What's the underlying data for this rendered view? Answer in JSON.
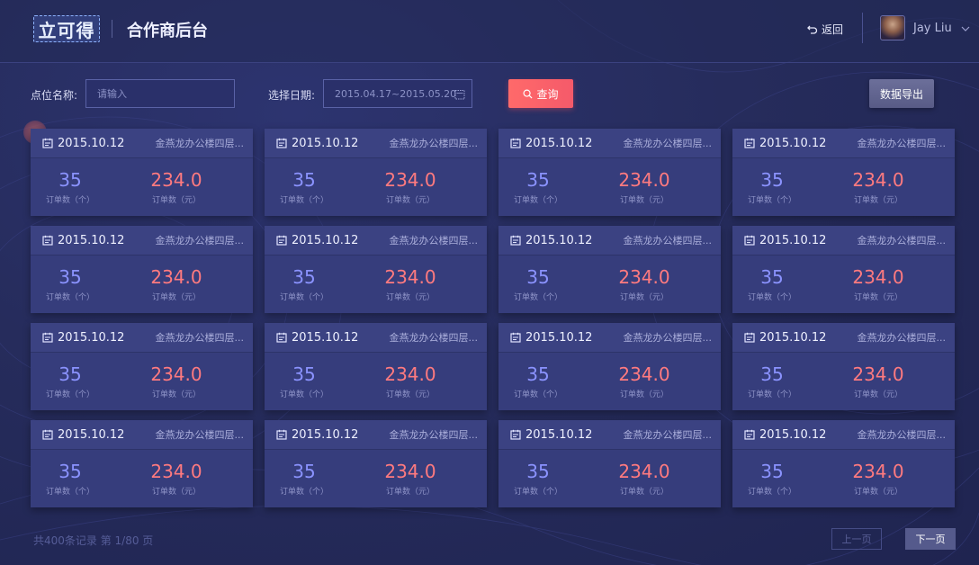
{
  "header": {
    "logo_text": "立可得",
    "title": "合作商后台",
    "back_label": "返回",
    "user_name": "Jay Liu"
  },
  "filters": {
    "location_label": "点位名称:",
    "location_placeholder": "请输入",
    "date_label": "选择日期:",
    "date_range": "2015.04.17~2015.05.20",
    "search_label": "查询",
    "export_label": "数据导出"
  },
  "card_template": {
    "order_count_label": "订单数（个）",
    "order_amount_label": "订单数（元）"
  },
  "cards": [
    {
      "date": "2015.10.12",
      "location": "金燕龙办公楼四层...",
      "order_count": "35",
      "order_amount": "234.0"
    },
    {
      "date": "2015.10.12",
      "location": "金燕龙办公楼四层...",
      "order_count": "35",
      "order_amount": "234.0"
    },
    {
      "date": "2015.10.12",
      "location": "金燕龙办公楼四层...",
      "order_count": "35",
      "order_amount": "234.0"
    },
    {
      "date": "2015.10.12",
      "location": "金燕龙办公楼四层...",
      "order_count": "35",
      "order_amount": "234.0"
    },
    {
      "date": "2015.10.12",
      "location": "金燕龙办公楼四层...",
      "order_count": "35",
      "order_amount": "234.0"
    },
    {
      "date": "2015.10.12",
      "location": "金燕龙办公楼四层...",
      "order_count": "35",
      "order_amount": "234.0"
    },
    {
      "date": "2015.10.12",
      "location": "金燕龙办公楼四层...",
      "order_count": "35",
      "order_amount": "234.0"
    },
    {
      "date": "2015.10.12",
      "location": "金燕龙办公楼四层...",
      "order_count": "35",
      "order_amount": "234.0"
    },
    {
      "date": "2015.10.12",
      "location": "金燕龙办公楼四层...",
      "order_count": "35",
      "order_amount": "234.0"
    },
    {
      "date": "2015.10.12",
      "location": "金燕龙办公楼四层...",
      "order_count": "35",
      "order_amount": "234.0"
    },
    {
      "date": "2015.10.12",
      "location": "金燕龙办公楼四层...",
      "order_count": "35",
      "order_amount": "234.0"
    },
    {
      "date": "2015.10.12",
      "location": "金燕龙办公楼四层...",
      "order_count": "35",
      "order_amount": "234.0"
    },
    {
      "date": "2015.10.12",
      "location": "金燕龙办公楼四层...",
      "order_count": "35",
      "order_amount": "234.0"
    },
    {
      "date": "2015.10.12",
      "location": "金燕龙办公楼四层...",
      "order_count": "35",
      "order_amount": "234.0"
    },
    {
      "date": "2015.10.12",
      "location": "金燕龙办公楼四层...",
      "order_count": "35",
      "order_amount": "234.0"
    },
    {
      "date": "2015.10.12",
      "location": "金燕龙办公楼四层...",
      "order_count": "35",
      "order_amount": "234.0"
    }
  ],
  "pagination": {
    "summary": "共400条记录  第 1/80 页",
    "prev_label": "上一页",
    "next_label": "下一页"
  },
  "colors": {
    "accent_red": "#ff6a6a",
    "count_blue": "#8b93ff",
    "amount_red": "#ff7a7f",
    "card_bg": "#363d7c",
    "page_bg": "#262c5c"
  },
  "icons": {
    "back": "back-arrow-icon",
    "calendar": "calendar-icon",
    "search": "search-icon",
    "chevron": "chevron-down-icon"
  }
}
